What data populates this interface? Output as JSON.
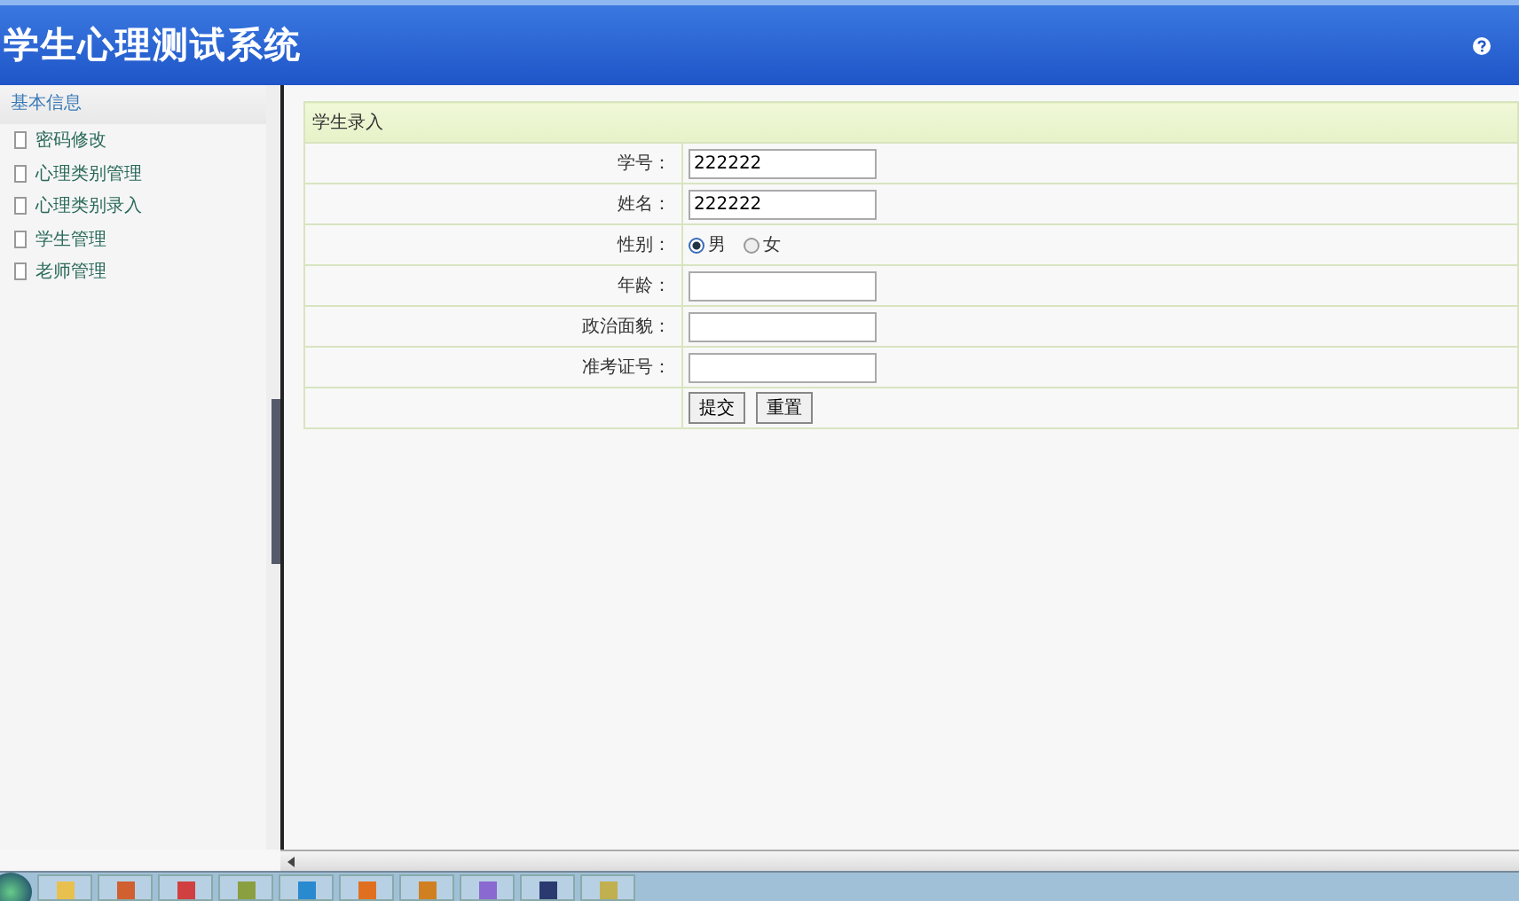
{
  "header": {
    "title": "学生心理测试系统"
  },
  "sidebar": {
    "title": "基本信息",
    "items": [
      {
        "label": "密码修改"
      },
      {
        "label": "心理类别管理"
      },
      {
        "label": "心理类别录入"
      },
      {
        "label": "学生管理"
      },
      {
        "label": "老师管理"
      }
    ]
  },
  "form": {
    "title": "学生录入",
    "fields": [
      {
        "kind": "text",
        "label": "学号：",
        "value": "222222"
      },
      {
        "kind": "text",
        "label": "姓名：",
        "value": "222222"
      },
      {
        "kind": "radio",
        "label": "性别：",
        "options": [
          {
            "label": "男",
            "selected": true
          },
          {
            "label": "女",
            "selected": false
          }
        ]
      },
      {
        "kind": "text",
        "label": "年龄："
      },
      {
        "kind": "text",
        "label": "政治面貌："
      },
      {
        "kind": "text",
        "label": "准考证号："
      }
    ],
    "buttons": [
      "提交",
      "重置"
    ]
  }
}
